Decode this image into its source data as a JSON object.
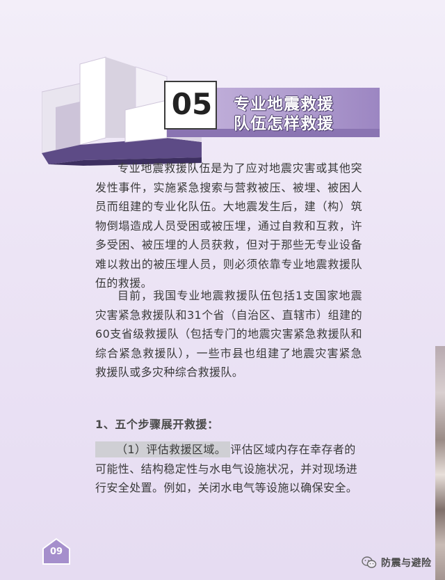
{
  "header": {
    "number": "05",
    "title_line1": "专业地震救援",
    "title_line2": "队伍怎样救援"
  },
  "body": {
    "paragraph1": "专业地震救援队伍是为了应对地震灾害或其他突发性事件，实施紧急搜索与营救被压、被埋、被困人员而组建的专业化队伍。大地震发生后，建（构）筑物倒塌造成人员受困或被压埋，通过自救和互救，许多受困、被压埋的人员获救，但对于那些无专业设备难以救出的被压埋人员，则必须依靠专业地震救援队伍的救援。",
    "paragraph2": "目前，我国专业地震救援队伍包括1支国家地震灾害紧急救援队和31个省（自治区、直辖市）组建的60支省级救援队（包括专门的地震灾害紧急救援队和综合紧急救援队），一些市县也组建了地震灾害紧急救援队或多灾种综合救援队。",
    "section_heading": "1、五个步骤展开救援：",
    "step1_label": "（1）评估救援区域。",
    "step1_text": "评估区域内存在幸存者的可能性、结构稳定性与水电气设施状况，并对现场进行安全处置。例如，关闭水电气等设施以确保安全。"
  },
  "footer": {
    "page_number": "09",
    "watermark_text": "防震与避险",
    "watermark_icon": "wechat-icon"
  },
  "colors": {
    "background": "#ece4f5",
    "banner": "#b29fd0",
    "accent": "#8a74b2",
    "badge": "#a58fcc"
  }
}
